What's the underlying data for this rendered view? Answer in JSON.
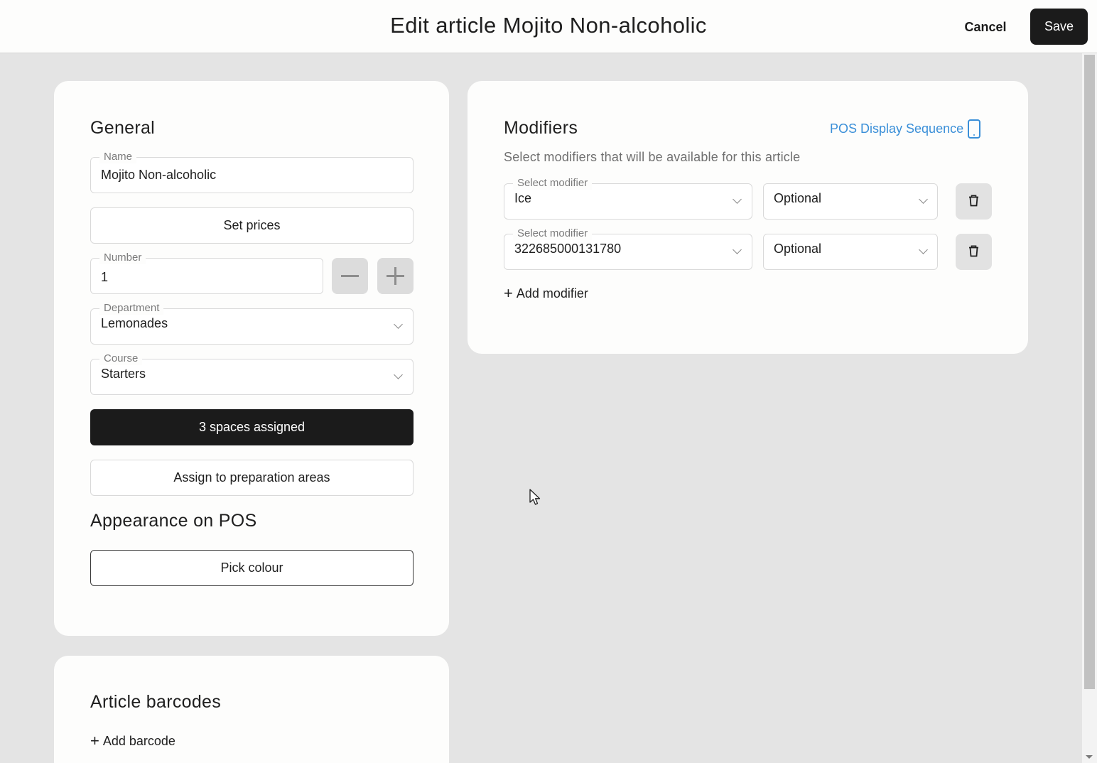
{
  "header": {
    "title": "Edit article Mojito Non-alcoholic",
    "cancel_label": "Cancel",
    "save_label": "Save"
  },
  "general": {
    "title": "General",
    "name_label": "Name",
    "name_value": "Mojito Non-alcoholic",
    "set_prices_label": "Set prices",
    "number_label": "Number",
    "number_value": "1",
    "department_label": "Department",
    "department_value": "Lemonades",
    "course_label": "Course",
    "course_value": "Starters",
    "spaces_label": "3 spaces assigned",
    "assign_prep_label": "Assign to preparation areas"
  },
  "appearance": {
    "title": "Appearance on POS",
    "pick_colour_label": "Pick colour"
  },
  "modifiers": {
    "title": "Modifiers",
    "pos_display_label": "POS Display Sequence",
    "subtitle": "Select modifiers that will be available for this article",
    "rows": [
      {
        "select_label": "Select modifier",
        "modifier_value": "Ice",
        "requirement": "Optional"
      },
      {
        "select_label": "Select modifier",
        "modifier_value": "322685000131780",
        "requirement": "Optional"
      }
    ],
    "add_label": "Add modifier"
  },
  "barcodes": {
    "title": "Article barcodes",
    "add_label": "Add barcode"
  },
  "colors": {
    "accent_link": "#3a8fd8",
    "dark_button": "#1b1b1b",
    "background": "#e4e4e4"
  },
  "icons": [
    "tablet-icon",
    "trash-icon",
    "chevron-down-icon",
    "plus-icon",
    "minus-icon",
    "cursor-pointer-icon"
  ]
}
